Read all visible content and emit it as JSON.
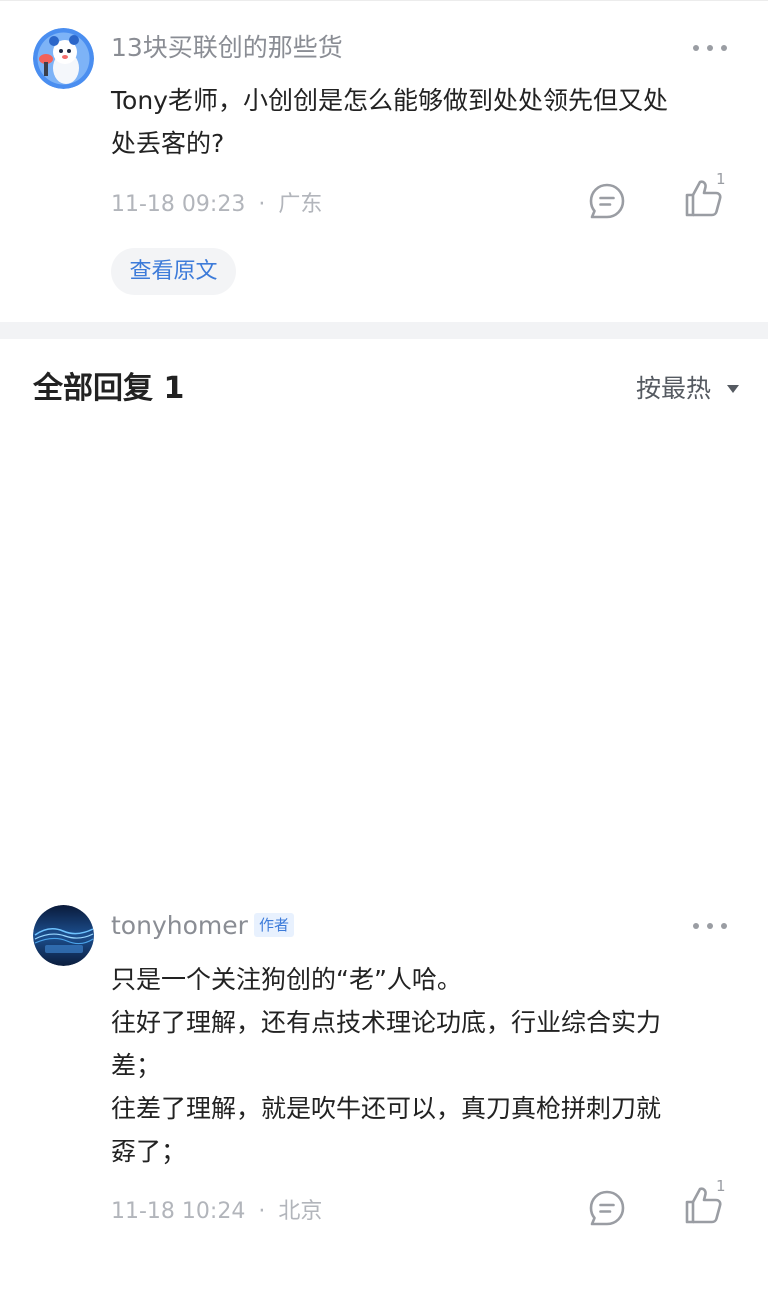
{
  "comment": {
    "username": "13块买联创的那些货",
    "text_lines": [
      "Tony老师，小创创是怎么能够做到处处领先但又处",
      "处丢客的?"
    ],
    "time": "11-18 09:23",
    "separator": "·",
    "location": "广东",
    "like_count": "1",
    "view_original_label": "查看原文"
  },
  "replies_header": {
    "title": "全部回复 1",
    "sort_label": "按最热"
  },
  "reply": {
    "username": "tonyhomer",
    "badge": "作者",
    "text_lines": [
      "只是一个关注狗创的“老”人哈。",
      "往好了理解，还有点技术理论功底，行业综合实力",
      "差；",
      "往差了理解，就是吹牛还可以，真刀真枪拼刺刀就",
      "孬了；"
    ],
    "time": "11-18 10:24",
    "separator": "·",
    "location": "北京",
    "like_count": "1"
  },
  "colors": {
    "link_blue": "#3d7bd9",
    "meta_gray": "#b2b5bb",
    "divider": "#f2f3f5"
  },
  "icons": {
    "more": "more-dots-icon",
    "reply": "comment-bubble-icon",
    "like": "thumbs-up-icon",
    "sort": "caret-down-icon"
  }
}
